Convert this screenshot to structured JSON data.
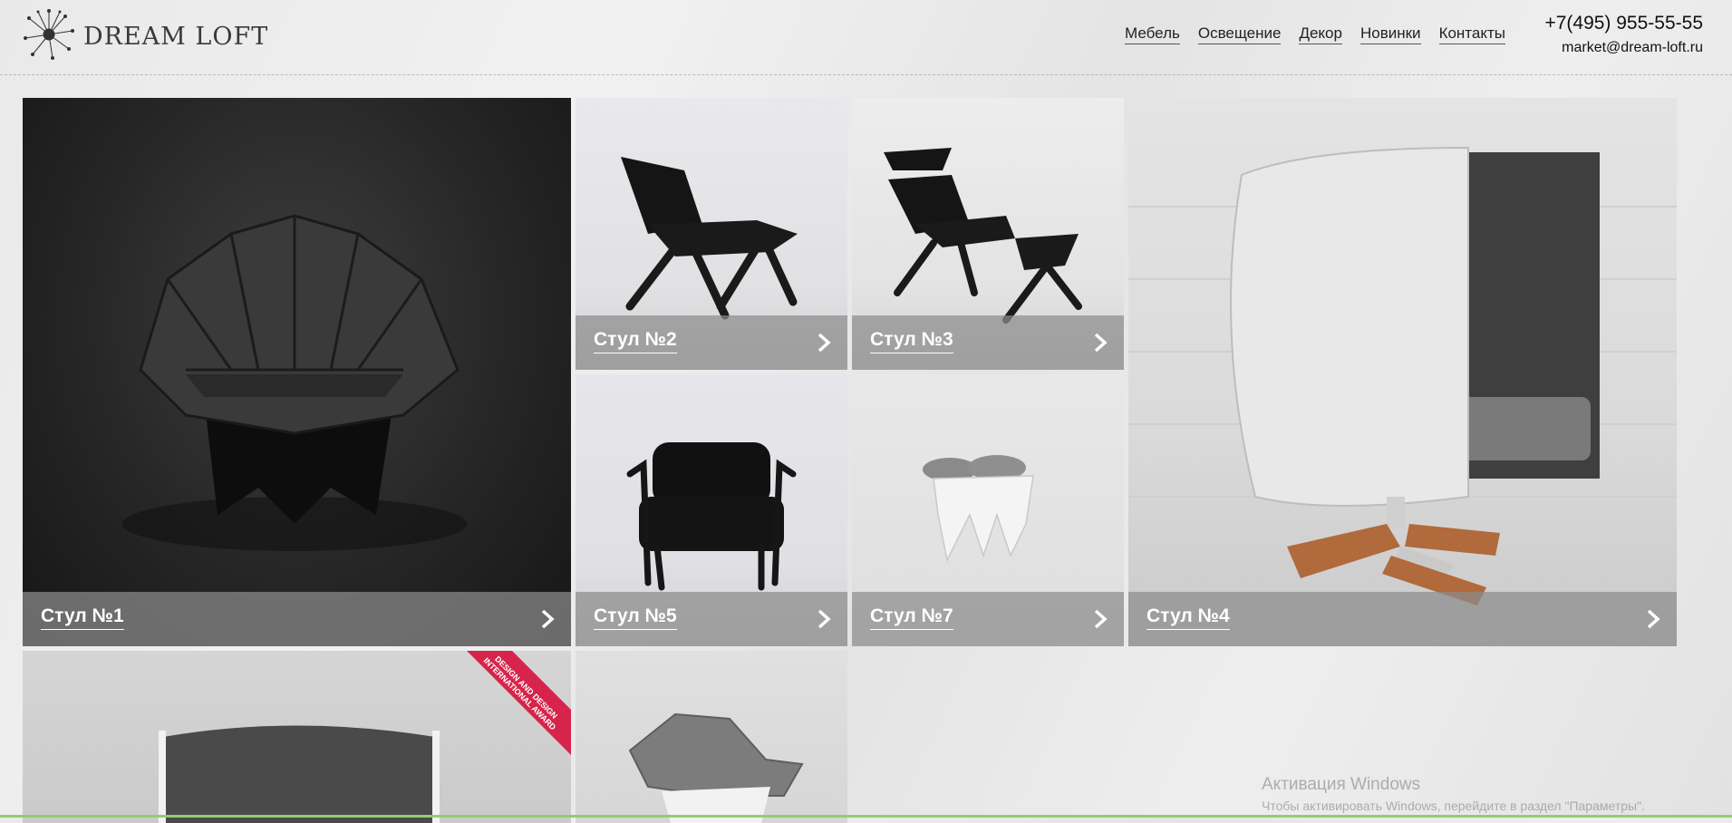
{
  "logo": {
    "text": "DREAM LOFT"
  },
  "nav": {
    "items": [
      "Мебель",
      "Освещение",
      "Декор",
      "Новинки",
      "Контакты"
    ]
  },
  "contacts": {
    "phone": "+7(495) 955-55-55",
    "email": "market@dream-loft.ru"
  },
  "products": [
    {
      "label": "Стул №1"
    },
    {
      "label": "Стул №2"
    },
    {
      "label": "Стул №3"
    },
    {
      "label": "Стул №4"
    },
    {
      "label": "Стул №5"
    },
    {
      "label": "Стул №7"
    }
  ],
  "award_ribbon": {
    "text": "DESIGN AND DESIGN INTERNATIONAL AWARD",
    "color": "#d6244a"
  },
  "windows_watermark": {
    "title": "Активация Windows",
    "subtitle": "Чтобы активировать Windows, перейдите в раздел \"Параметры\"."
  }
}
